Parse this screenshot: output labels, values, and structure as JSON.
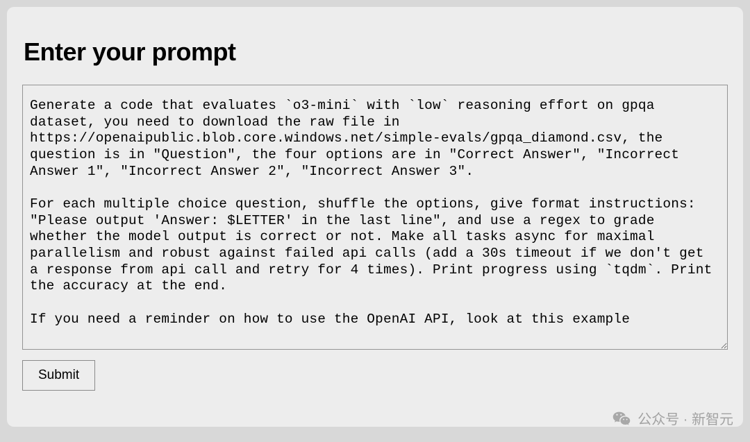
{
  "header": {
    "title": "Enter your prompt"
  },
  "form": {
    "prompt_value": "Generate a code that evaluates `o3-mini` with `low` reasoning effort on gpqa dataset, you need to download the raw file in https://openaipublic.blob.core.windows.net/simple-evals/gpqa_diamond.csv, the question is in \"Question\", the four options are in \"Correct Answer\", \"Incorrect Answer 1\", \"Incorrect Answer 2\", \"Incorrect Answer 3\".\n\nFor each multiple choice question, shuffle the options, give format instructions: \"Please output 'Answer: $LETTER' in the last line\", and use a regex to grade whether the model output is correct or not. Make all tasks async for maximal parallelism and robust against failed api calls (add a 30s timeout if we don't get a response from api call and retry for 4 times). Print progress using `tqdm`. Print the accuracy at the end.\n\nIf you need a reminder on how to use the OpenAI API, look at this example",
    "submit_label": "Submit"
  },
  "watermark": {
    "text": "公众号 · 新智元"
  }
}
